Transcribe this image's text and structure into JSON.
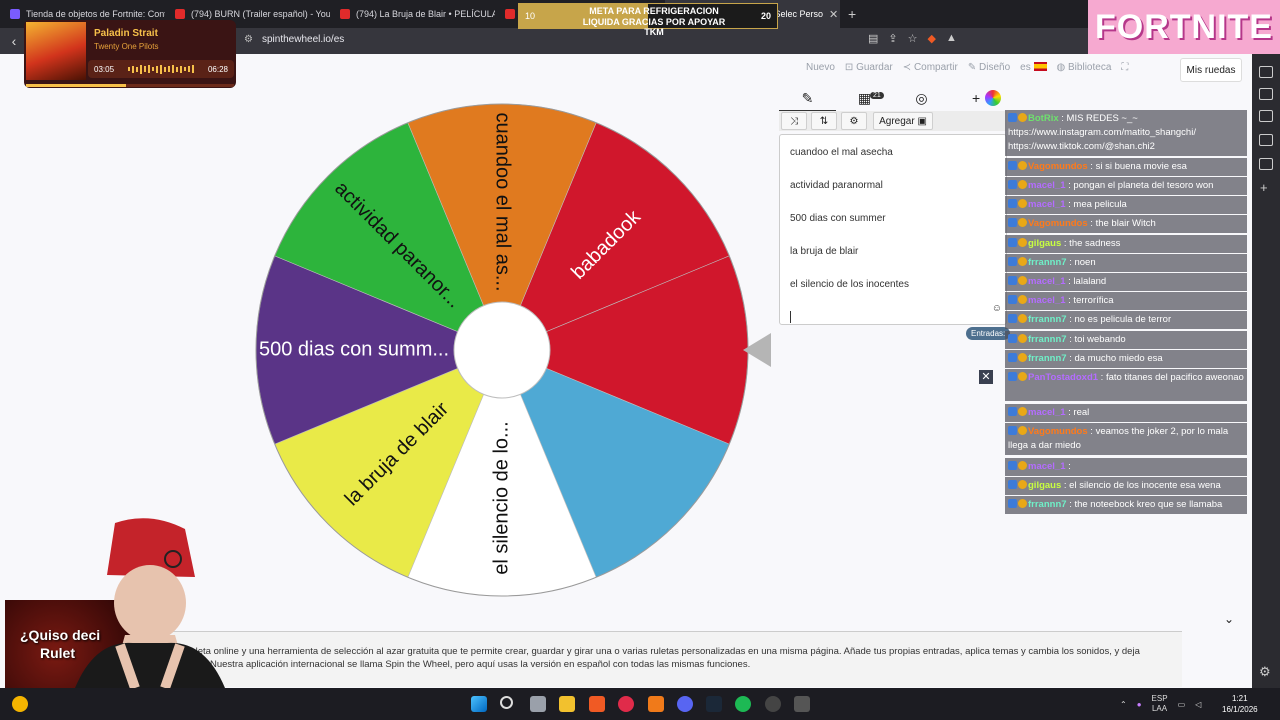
{
  "browser": {
    "tabs": [
      {
        "label": "Tienda de objetos de Fortnite: Conte",
        "favicon": "fortnite-icon"
      },
      {
        "label": "(794) BURN (Trailer español) - YouTu",
        "favicon": "youtube-icon"
      },
      {
        "label": "(794) La Bruja de Blair • PELÍCULA DE",
        "favicon": "youtube-icon"
      },
      {
        "label": "toria - Selec Perso",
        "favicon": "wheel-icon",
        "active": true
      }
    ],
    "url": "spinthewheel.io/es"
  },
  "meta_banner": {
    "left_value": "10",
    "line1": "META PARA REFRIGERACION",
    "line2": "LIQUIDA GRACIAS POR APOYAR TKM",
    "right_value": "20",
    "progress": 0.5
  },
  "music": {
    "title": "Paladin Strait",
    "artist": "Twenty One Pilots",
    "elapsed": "03:05",
    "total": "06:28",
    "progress": 0.48
  },
  "brand_banner": "FORTNITE",
  "page_menu": {
    "nuevo": "Nuevo",
    "guardar": "Guardar",
    "compartir": "Compartir",
    "diseno": "Diseño",
    "lang": "es",
    "biblioteca": "Biblioteca",
    "mis_ruedas": "Mis ruedas"
  },
  "editor": {
    "list_badge": "21",
    "add_label": "Agregar",
    "entries": [
      "cuandoo el mal asecha",
      "actividad paranormal",
      "500 dias con summer",
      "la bruja de blair",
      "el silencio de los inocentes"
    ],
    "entries_pill": "Entradas:"
  },
  "chart_data": {
    "type": "pie",
    "title": "",
    "categories": [
      "babadook",
      "",
      "",
      "el silencio de lo...",
      "la bruja de blair",
      "500 dias con summ...",
      "actividad paranor...",
      "cuandoo el mal as..."
    ],
    "values": [
      1,
      1,
      1,
      1,
      1,
      1,
      1,
      1
    ],
    "colors": [
      "#d0172c",
      "#d0172c",
      "#4fa9d4",
      "#ffffff",
      "#e9ea48",
      "#5a3487",
      "#2db43c",
      "#e07a1f"
    ]
  },
  "chat": [
    {
      "user": "BotRix",
      "color": "#6ee06e",
      "text": ": MIS REDES ~_~ https://www.instagram.com/matito_shangchi/ https://www.tiktok.com/@shan.chi2"
    },
    {
      "user": "Vagomundos",
      "color": "#ff7a1a",
      "text": ": si si buena movie esa"
    },
    {
      "user": "macel_1",
      "color": "#b46cff",
      "text": ": pongan el planeta del tesoro won"
    },
    {
      "user": "macel_1",
      "color": "#b46cff",
      "text": ": mea pelicula"
    },
    {
      "user": "Vagomundos",
      "color": "#ff7a1a",
      "text": ": the blair Witch"
    },
    {
      "user": "gilgaus",
      "color": "#c8ff40",
      "text": ": the sadness"
    },
    {
      "user": "frrannn7",
      "color": "#6ff0c8",
      "text": ": noen"
    },
    {
      "user": "macel_1",
      "color": "#b46cff",
      "text": ": lalaland"
    },
    {
      "user": "macel_1",
      "color": "#b46cff",
      "text": ": terrorífica"
    },
    {
      "user": "frrannn7",
      "color": "#6ff0c8",
      "text": ": no es pelicula de terror"
    },
    {
      "user": "frrannn7",
      "color": "#6ff0c8",
      "text": ": toi webando"
    },
    {
      "user": "frrannn7",
      "color": "#6ff0c8",
      "text": ": da mucho miedo esa"
    },
    {
      "user": "PanTostadoxd1",
      "color": "#b46cff",
      "text": ": fato titanes del pacifico aweonao"
    },
    {
      "user": "macel_1",
      "color": "#b46cff",
      "text": ": real"
    },
    {
      "user": "Vagomundos",
      "color": "#ff7a1a",
      "text": ": veamos the joker 2, por lo mala llega a dar miedo"
    },
    {
      "user": "macel_1",
      "color": "#b46cff",
      "text": ":"
    },
    {
      "user": "gilgaus",
      "color": "#c8ff40",
      "text": ": el silencio de los inocente esa wena"
    },
    {
      "user": "frrannn7",
      "color": "#6ff0c8",
      "text": ": the noteebock kreo que se llamaba"
    }
  ],
  "description": {
    "line1": "na ruleta online y una herramienta de selección al azar gratuita que te permite crear, guardar y girar una o varias ruletas personalizadas en una misma página. Añade tus propias entradas, aplica temas y cambia los sonidos, y deja",
    "line2": "Nuestra aplicación internacional se llama Spin the Wheel, pero aquí usas la versión en español con todas las mismas funciones."
  },
  "overlay": {
    "line1": "¿Quiso deci",
    "line2": "Rulet"
  },
  "taskbar": {
    "lang1": "ESP",
    "lang2": "LAA",
    "time": "1:21",
    "date": "16/1/2026"
  }
}
